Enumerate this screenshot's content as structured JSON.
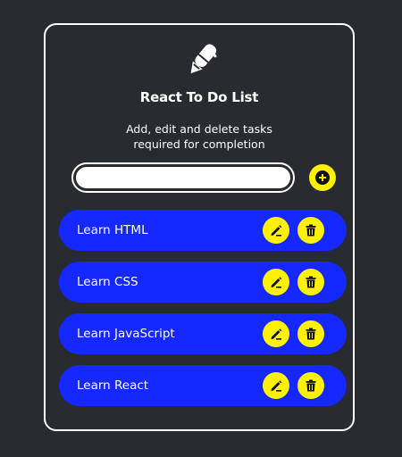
{
  "app": {
    "title": "React To Do List",
    "subtitle_line1": "Add, edit and delete tasks",
    "subtitle_line2": "required for completion",
    "logo_icon": "pen-icon"
  },
  "input": {
    "value": "",
    "placeholder": ""
  },
  "add_button": {
    "icon": "plus-circle-icon"
  },
  "tasks": [
    {
      "label": "Learn HTML"
    },
    {
      "label": "Learn CSS"
    },
    {
      "label": "Learn JavaScript"
    },
    {
      "label": "Learn React"
    }
  ],
  "task_actions": {
    "edit_icon": "pencil-icon",
    "delete_icon": "trash-icon"
  },
  "colors": {
    "background": "#282b30",
    "task_bg": "#1428ff",
    "accent": "#fff200",
    "text": "#ffffff"
  }
}
